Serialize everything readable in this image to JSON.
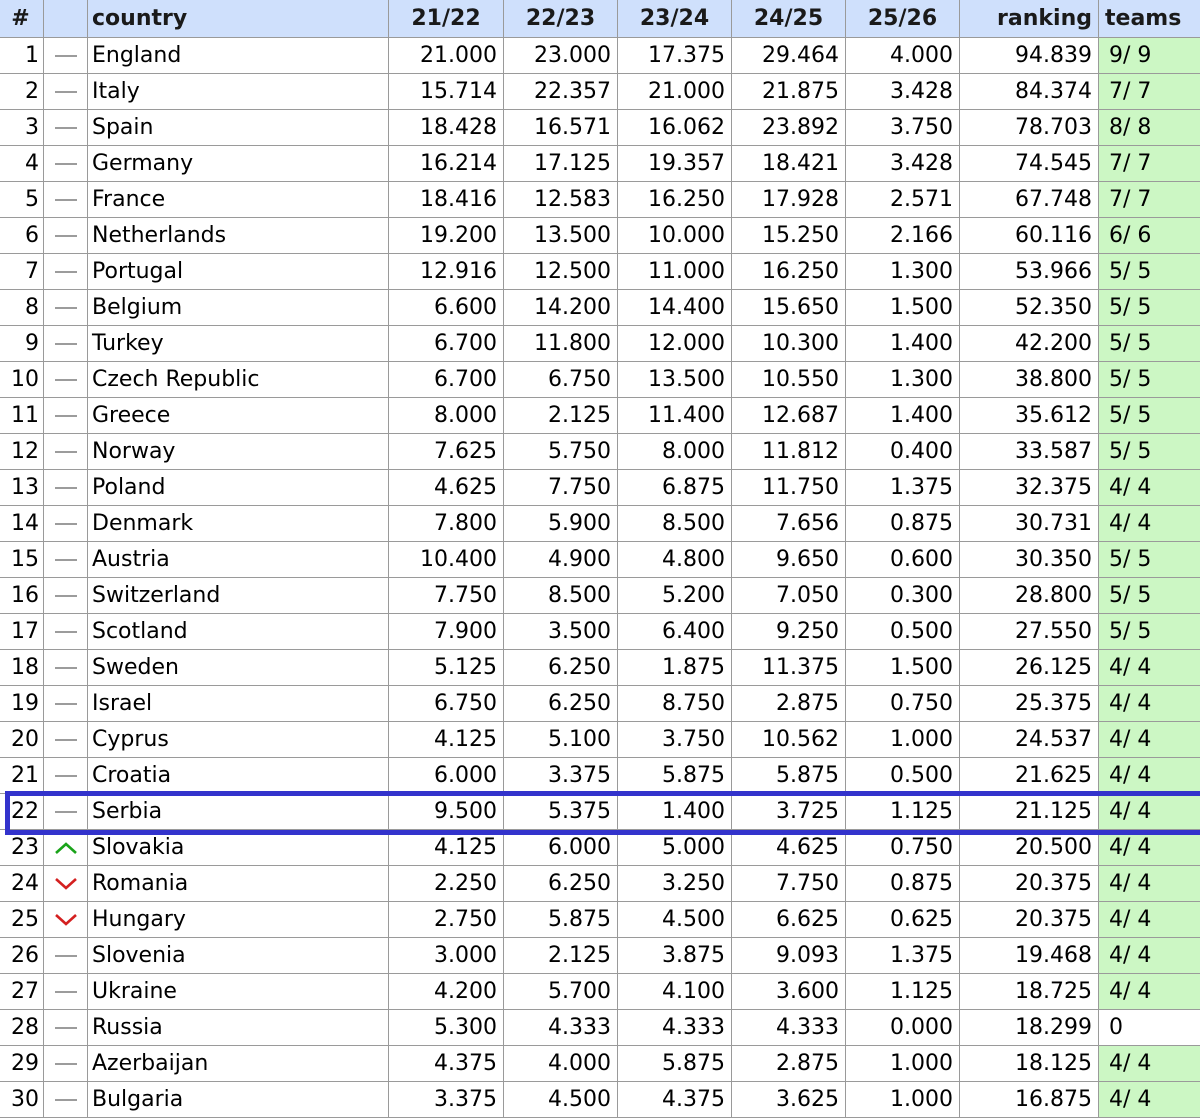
{
  "colors": {
    "header_bg": "#cfe0fc",
    "teams_bg": "#ccf7c4",
    "highlight": "#3333cc",
    "up": "#1aa31a",
    "down": "#d42020",
    "same": "#9c9c9c"
  },
  "header": {
    "rank": "#",
    "move": "",
    "country": "country",
    "y1": "21/22",
    "y2": "22/23",
    "y3": "23/24",
    "y4": "24/25",
    "y5": "25/26",
    "ranking": "ranking",
    "teams": "teams"
  },
  "rows": [
    {
      "rank": "1",
      "move": "same",
      "country": "England",
      "y1": "21.000",
      "y2": "23.000",
      "y3": "17.375",
      "y4": "29.464",
      "y5": "4.000",
      "ranking": "94.839",
      "teams": "9/ 9",
      "teams_bg": "green"
    },
    {
      "rank": "2",
      "move": "same",
      "country": "Italy",
      "y1": "15.714",
      "y2": "22.357",
      "y3": "21.000",
      "y4": "21.875",
      "y5": "3.428",
      "ranking": "84.374",
      "teams": "7/ 7",
      "teams_bg": "green"
    },
    {
      "rank": "3",
      "move": "same",
      "country": "Spain",
      "y1": "18.428",
      "y2": "16.571",
      "y3": "16.062",
      "y4": "23.892",
      "y5": "3.750",
      "ranking": "78.703",
      "teams": "8/ 8",
      "teams_bg": "green"
    },
    {
      "rank": "4",
      "move": "same",
      "country": "Germany",
      "y1": "16.214",
      "y2": "17.125",
      "y3": "19.357",
      "y4": "18.421",
      "y5": "3.428",
      "ranking": "74.545",
      "teams": "7/ 7",
      "teams_bg": "green"
    },
    {
      "rank": "5",
      "move": "same",
      "country": "France",
      "y1": "18.416",
      "y2": "12.583",
      "y3": "16.250",
      "y4": "17.928",
      "y5": "2.571",
      "ranking": "67.748",
      "teams": "7/ 7",
      "teams_bg": "green"
    },
    {
      "rank": "6",
      "move": "same",
      "country": "Netherlands",
      "y1": "19.200",
      "y2": "13.500",
      "y3": "10.000",
      "y4": "15.250",
      "y5": "2.166",
      "ranking": "60.116",
      "teams": "6/ 6",
      "teams_bg": "green"
    },
    {
      "rank": "7",
      "move": "same",
      "country": "Portugal",
      "y1": "12.916",
      "y2": "12.500",
      "y3": "11.000",
      "y4": "16.250",
      "y5": "1.300",
      "ranking": "53.966",
      "teams": "5/ 5",
      "teams_bg": "green"
    },
    {
      "rank": "8",
      "move": "same",
      "country": "Belgium",
      "y1": "6.600",
      "y2": "14.200",
      "y3": "14.400",
      "y4": "15.650",
      "y5": "1.500",
      "ranking": "52.350",
      "teams": "5/ 5",
      "teams_bg": "green"
    },
    {
      "rank": "9",
      "move": "same",
      "country": "Turkey",
      "y1": "6.700",
      "y2": "11.800",
      "y3": "12.000",
      "y4": "10.300",
      "y5": "1.400",
      "ranking": "42.200",
      "teams": "5/ 5",
      "teams_bg": "green"
    },
    {
      "rank": "10",
      "move": "same",
      "country": "Czech Republic",
      "y1": "6.700",
      "y2": "6.750",
      "y3": "13.500",
      "y4": "10.550",
      "y5": "1.300",
      "ranking": "38.800",
      "teams": "5/ 5",
      "teams_bg": "green"
    },
    {
      "rank": "11",
      "move": "same",
      "country": "Greece",
      "y1": "8.000",
      "y2": "2.125",
      "y3": "11.400",
      "y4": "12.687",
      "y5": "1.400",
      "ranking": "35.612",
      "teams": "5/ 5",
      "teams_bg": "green"
    },
    {
      "rank": "12",
      "move": "same",
      "country": "Norway",
      "y1": "7.625",
      "y2": "5.750",
      "y3": "8.000",
      "y4": "11.812",
      "y5": "0.400",
      "ranking": "33.587",
      "teams": "5/ 5",
      "teams_bg": "green"
    },
    {
      "rank": "13",
      "move": "same",
      "country": "Poland",
      "y1": "4.625",
      "y2": "7.750",
      "y3": "6.875",
      "y4": "11.750",
      "y5": "1.375",
      "ranking": "32.375",
      "teams": "4/ 4",
      "teams_bg": "green"
    },
    {
      "rank": "14",
      "move": "same",
      "country": "Denmark",
      "y1": "7.800",
      "y2": "5.900",
      "y3": "8.500",
      "y4": "7.656",
      "y5": "0.875",
      "ranking": "30.731",
      "teams": "4/ 4",
      "teams_bg": "green"
    },
    {
      "rank": "15",
      "move": "same",
      "country": "Austria",
      "y1": "10.400",
      "y2": "4.900",
      "y3": "4.800",
      "y4": "9.650",
      "y5": "0.600",
      "ranking": "30.350",
      "teams": "5/ 5",
      "teams_bg": "green"
    },
    {
      "rank": "16",
      "move": "same",
      "country": "Switzerland",
      "y1": "7.750",
      "y2": "8.500",
      "y3": "5.200",
      "y4": "7.050",
      "y5": "0.300",
      "ranking": "28.800",
      "teams": "5/ 5",
      "teams_bg": "green"
    },
    {
      "rank": "17",
      "move": "same",
      "country": "Scotland",
      "y1": "7.900",
      "y2": "3.500",
      "y3": "6.400",
      "y4": "9.250",
      "y5": "0.500",
      "ranking": "27.550",
      "teams": "5/ 5",
      "teams_bg": "green"
    },
    {
      "rank": "18",
      "move": "same",
      "country": "Sweden",
      "y1": "5.125",
      "y2": "6.250",
      "y3": "1.875",
      "y4": "11.375",
      "y5": "1.500",
      "ranking": "26.125",
      "teams": "4/ 4",
      "teams_bg": "green"
    },
    {
      "rank": "19",
      "move": "same",
      "country": "Israel",
      "y1": "6.750",
      "y2": "6.250",
      "y3": "8.750",
      "y4": "2.875",
      "y5": "0.750",
      "ranking": "25.375",
      "teams": "4/ 4",
      "teams_bg": "green"
    },
    {
      "rank": "20",
      "move": "same",
      "country": "Cyprus",
      "y1": "4.125",
      "y2": "5.100",
      "y3": "3.750",
      "y4": "10.562",
      "y5": "1.000",
      "ranking": "24.537",
      "teams": "4/ 4",
      "teams_bg": "green"
    },
    {
      "rank": "21",
      "move": "same",
      "country": "Croatia",
      "y1": "6.000",
      "y2": "3.375",
      "y3": "5.875",
      "y4": "5.875",
      "y5": "0.500",
      "ranking": "21.625",
      "teams": "4/ 4",
      "teams_bg": "green"
    },
    {
      "rank": "22",
      "move": "same",
      "country": "Serbia",
      "y1": "9.500",
      "y2": "5.375",
      "y3": "1.400",
      "y4": "3.725",
      "y5": "1.125",
      "ranking": "21.125",
      "teams": "4/ 4",
      "teams_bg": "green"
    },
    {
      "rank": "23",
      "move": "up",
      "country": "Slovakia",
      "y1": "4.125",
      "y2": "6.000",
      "y3": "5.000",
      "y4": "4.625",
      "y5": "0.750",
      "ranking": "20.500",
      "teams": "4/ 4",
      "teams_bg": "green"
    },
    {
      "rank": "24",
      "move": "down",
      "country": "Romania",
      "y1": "2.250",
      "y2": "6.250",
      "y3": "3.250",
      "y4": "7.750",
      "y5": "0.875",
      "ranking": "20.375",
      "teams": "4/ 4",
      "teams_bg": "green"
    },
    {
      "rank": "25",
      "move": "down",
      "country": "Hungary",
      "y1": "2.750",
      "y2": "5.875",
      "y3": "4.500",
      "y4": "6.625",
      "y5": "0.625",
      "ranking": "20.375",
      "teams": "4/ 4",
      "teams_bg": "green"
    },
    {
      "rank": "26",
      "move": "same",
      "country": "Slovenia",
      "y1": "3.000",
      "y2": "2.125",
      "y3": "3.875",
      "y4": "9.093",
      "y5": "1.375",
      "ranking": "19.468",
      "teams": "4/ 4",
      "teams_bg": "green"
    },
    {
      "rank": "27",
      "move": "same",
      "country": "Ukraine",
      "y1": "4.200",
      "y2": "5.700",
      "y3": "4.100",
      "y4": "3.600",
      "y5": "1.125",
      "ranking": "18.725",
      "teams": "4/ 4",
      "teams_bg": "green"
    },
    {
      "rank": "28",
      "move": "same",
      "country": "Russia",
      "y1": "5.300",
      "y2": "4.333",
      "y3": "4.333",
      "y4": "4.333",
      "y5": "0.000",
      "ranking": "18.299",
      "teams": "0",
      "teams_bg": "white"
    },
    {
      "rank": "29",
      "move": "same",
      "country": "Azerbaijan",
      "y1": "4.375",
      "y2": "4.000",
      "y3": "5.875",
      "y4": "2.875",
      "y5": "1.000",
      "ranking": "18.125",
      "teams": "4/ 4",
      "teams_bg": "green"
    },
    {
      "rank": "30",
      "move": "same",
      "country": "Bulgaria",
      "y1": "3.375",
      "y2": "4.500",
      "y3": "4.375",
      "y4": "3.625",
      "y5": "1.000",
      "ranking": "16.875",
      "teams": "4/ 4",
      "teams_bg": "green"
    }
  ],
  "highlighted_rank": "22"
}
